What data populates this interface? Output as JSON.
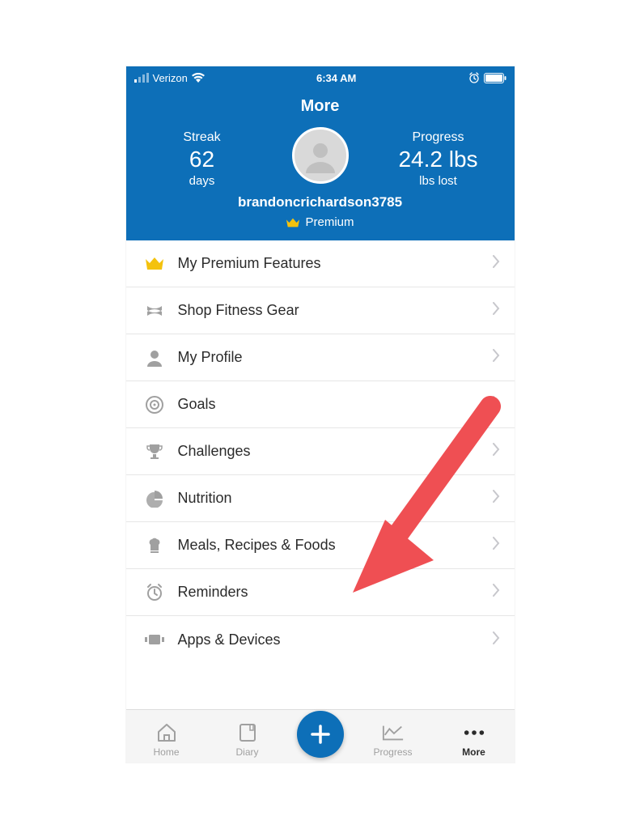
{
  "statusbar": {
    "carrier": "Verizon",
    "time": "6:34 AM"
  },
  "header": {
    "title": "More",
    "streak": {
      "label": "Streak",
      "value": "62",
      "unit": "days"
    },
    "progress": {
      "label": "Progress",
      "value": "24.2 lbs",
      "unit": "lbs lost"
    },
    "username": "brandoncrichardson3785",
    "premium_label": "Premium"
  },
  "menu": [
    {
      "id": "premium-features",
      "label": "My Premium Features",
      "icon": "crown",
      "gold": true
    },
    {
      "id": "shop-fitness",
      "label": "Shop Fitness Gear",
      "icon": "ua"
    },
    {
      "id": "my-profile",
      "label": "My Profile",
      "icon": "person"
    },
    {
      "id": "goals",
      "label": "Goals",
      "icon": "target"
    },
    {
      "id": "challenges",
      "label": "Challenges",
      "icon": "trophy"
    },
    {
      "id": "nutrition",
      "label": "Nutrition",
      "icon": "pie"
    },
    {
      "id": "meals",
      "label": "Meals, Recipes & Foods",
      "icon": "chef"
    },
    {
      "id": "reminders",
      "label": "Reminders",
      "icon": "alarm"
    },
    {
      "id": "apps-devices",
      "label": "Apps & Devices",
      "icon": "device"
    }
  ],
  "tabbar": {
    "home": "Home",
    "diary": "Diary",
    "progress": "Progress",
    "more": "More"
  },
  "colors": {
    "brand": "#0d6fb8",
    "gold": "#f4c20d",
    "arrow": "#ef4f53"
  }
}
